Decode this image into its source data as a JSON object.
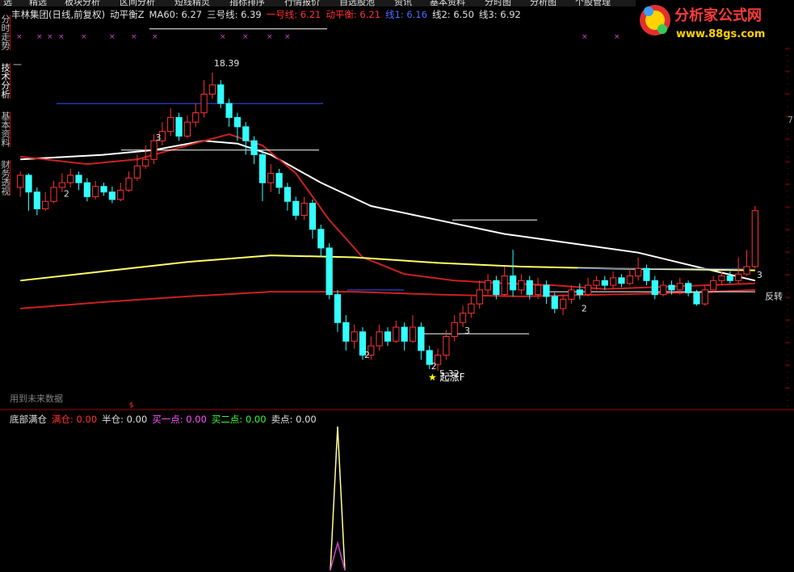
{
  "menu": [
    "选",
    "精选",
    "板块分析",
    "区间分析",
    "短线精灵",
    "指标排序",
    "行情报价",
    "自选股池",
    "资讯",
    "基本资料",
    "分时图",
    "分析图",
    "个股管理"
  ],
  "sidebar_tabs": [
    "分时走势",
    "技术分析",
    "基本资料",
    "财务透视"
  ],
  "legend_main": [
    {
      "text": "丰林集团(日线,前复权)",
      "color": "#e0e0e0"
    },
    {
      "text": "动平衡Z",
      "color": "#e0e0e0"
    },
    {
      "text": "MA60: 6.27",
      "color": "#e0e0e0"
    },
    {
      "text": "三号线: 6.39",
      "color": "#e0e0e0"
    },
    {
      "text": "一号线: 6.21",
      "color": "#ff3333"
    },
    {
      "text": "动平衡: 6.21",
      "color": "#ff3333"
    },
    {
      "text": "线1: 6.16",
      "color": "#4f6bff"
    },
    {
      "text": "线2: 6.50",
      "color": "#e0e0e0"
    },
    {
      "text": "线3: 6.92",
      "color": "#e0e0e0"
    }
  ],
  "legend_sub": [
    {
      "text": "底部满仓",
      "color": "#e0e0e0"
    },
    {
      "text": "满仓: 0.00",
      "color": "#ff3333"
    },
    {
      "text": "半仓: 0.00",
      "color": "#e0e0e0"
    },
    {
      "text": "买一点: 0.00",
      "color": "#ff55ff"
    },
    {
      "text": "买二点: 0.00",
      "color": "#33ff33"
    },
    {
      "text": "卖点: 0.00",
      "color": "#e0e0e0"
    }
  ],
  "logo": {
    "title": "分析家公式网",
    "url": "www.88gs.com"
  },
  "future_note": "用到未来数据",
  "signal_label": "起涨F",
  "side_labels": {
    "left_mark": "一",
    "right_mark": "7"
  },
  "chart_data": {
    "type": "candlestick",
    "series_note": "daily candles, front-adjusted",
    "candles": [
      [
        0,
        6.05,
        6.18,
        6.22,
        5.95
      ],
      [
        1,
        6.18,
        6.0,
        6.2,
        5.8
      ],
      [
        2,
        6.0,
        5.82,
        6.05,
        5.75
      ],
      [
        3,
        5.82,
        5.9,
        6.0,
        5.8
      ],
      [
        4,
        5.9,
        6.05,
        6.12,
        5.88
      ],
      [
        5,
        6.05,
        6.1,
        6.2,
        6.0
      ],
      [
        6,
        6.1,
        6.18,
        6.25,
        6.05
      ],
      [
        7,
        6.18,
        6.1,
        6.22,
        6.02
      ],
      [
        8,
        6.1,
        5.95,
        6.15,
        5.9
      ],
      [
        9,
        5.95,
        6.06,
        6.12,
        5.92
      ],
      [
        10,
        6.06,
        6.0,
        6.1,
        5.96
      ],
      [
        11,
        6.0,
        5.92,
        6.06,
        5.88
      ],
      [
        12,
        5.92,
        6.02,
        6.1,
        5.9
      ],
      [
        13,
        6.02,
        6.15,
        6.22,
        6.0
      ],
      [
        14,
        6.15,
        6.28,
        6.4,
        6.12
      ],
      [
        15,
        6.28,
        6.35,
        6.5,
        6.25
      ],
      [
        16,
        6.35,
        6.55,
        6.62,
        6.3
      ],
      [
        17,
        6.55,
        6.65,
        6.75,
        6.5
      ],
      [
        18,
        6.65,
        6.8,
        6.9,
        6.6
      ],
      [
        19,
        6.8,
        6.6,
        6.85,
        6.55
      ],
      [
        20,
        6.6,
        6.75,
        6.82,
        6.58
      ],
      [
        21,
        6.75,
        6.85,
        6.95,
        6.7
      ],
      [
        22,
        6.85,
        7.05,
        7.2,
        6.8
      ],
      [
        23,
        7.05,
        7.15,
        7.28,
        7.0
      ],
      [
        24,
        7.15,
        6.95,
        7.2,
        6.9
      ],
      [
        25,
        6.95,
        6.8,
        7.0,
        6.7
      ],
      [
        26,
        6.8,
        6.7,
        6.85,
        6.55
      ],
      [
        27,
        6.7,
        6.55,
        6.75,
        6.4
      ],
      [
        28,
        6.55,
        6.4,
        6.6,
        6.3
      ],
      [
        29,
        6.4,
        6.1,
        6.45,
        5.9
      ],
      [
        30,
        6.1,
        6.2,
        6.3,
        6.0
      ],
      [
        31,
        6.2,
        6.05,
        6.25,
        5.98
      ],
      [
        32,
        6.05,
        5.9,
        6.1,
        5.8
      ],
      [
        33,
        5.9,
        5.75,
        5.95,
        5.7
      ],
      [
        34,
        5.75,
        5.88,
        5.95,
        5.7
      ],
      [
        35,
        5.88,
        5.6,
        5.92,
        5.5
      ],
      [
        36,
        5.6,
        5.4,
        5.65,
        5.3
      ],
      [
        37,
        5.4,
        4.9,
        5.45,
        4.85
      ],
      [
        38,
        4.9,
        4.6,
        4.95,
        4.5
      ],
      [
        39,
        4.6,
        4.4,
        4.68,
        4.3
      ],
      [
        40,
        4.4,
        4.5,
        4.58,
        4.32
      ],
      [
        41,
        4.5,
        4.25,
        4.55,
        4.2
      ],
      [
        42,
        4.25,
        4.35,
        4.45,
        4.2
      ],
      [
        43,
        4.35,
        4.5,
        4.58,
        4.3
      ],
      [
        44,
        4.5,
        4.4,
        4.55,
        4.35
      ],
      [
        45,
        4.4,
        4.55,
        4.62,
        4.38
      ],
      [
        46,
        4.55,
        4.4,
        4.6,
        4.3
      ],
      [
        47,
        4.4,
        4.55,
        4.68,
        4.38
      ],
      [
        48,
        4.55,
        4.3,
        4.6,
        4.2
      ],
      [
        49,
        4.3,
        4.15,
        4.35,
        4.1
      ],
      [
        50,
        4.15,
        4.25,
        4.32,
        4.08
      ],
      [
        51,
        4.25,
        4.45,
        4.52,
        4.2
      ],
      [
        52,
        4.45,
        4.6,
        4.68,
        4.4
      ],
      [
        53,
        4.6,
        4.7,
        4.78,
        4.55
      ],
      [
        54,
        4.7,
        4.8,
        4.88,
        4.65
      ],
      [
        55,
        4.8,
        4.95,
        5.05,
        4.75
      ],
      [
        56,
        4.95,
        5.05,
        5.12,
        4.9
      ],
      [
        57,
        5.05,
        4.9,
        5.1,
        4.85
      ],
      [
        58,
        4.9,
        5.1,
        5.2,
        4.88
      ],
      [
        59,
        5.1,
        4.95,
        5.38,
        4.88
      ],
      [
        60,
        4.95,
        5.05,
        5.12,
        4.9
      ],
      [
        61,
        5.05,
        4.9,
        5.1,
        4.85
      ],
      [
        62,
        4.9,
        5.0,
        5.08,
        4.85
      ],
      [
        63,
        5.0,
        4.88,
        5.05,
        4.8
      ],
      [
        64,
        4.88,
        4.75,
        4.92,
        4.7
      ],
      [
        65,
        4.75,
        4.85,
        4.9,
        4.68
      ],
      [
        66,
        4.85,
        4.95,
        5.0,
        4.8
      ],
      [
        67,
        4.95,
        4.9,
        5.02,
        4.85
      ],
      [
        68,
        4.9,
        5.0,
        5.08,
        4.88
      ],
      [
        69,
        5.0,
        5.05,
        5.1,
        4.95
      ],
      [
        70,
        5.05,
        5.0,
        5.1,
        4.95
      ],
      [
        71,
        5.0,
        5.08,
        5.15,
        4.96
      ],
      [
        72,
        5.08,
        5.02,
        5.12,
        4.98
      ],
      [
        73,
        5.02,
        5.1,
        5.18,
        5.0
      ],
      [
        74,
        5.1,
        5.18,
        5.3,
        5.05
      ],
      [
        75,
        5.18,
        5.05,
        5.22,
        5.0
      ],
      [
        76,
        5.05,
        4.9,
        5.1,
        4.85
      ],
      [
        77,
        4.9,
        5.0,
        5.05,
        4.88
      ],
      [
        78,
        5.0,
        4.95,
        5.05,
        4.9
      ],
      [
        79,
        4.95,
        5.02,
        5.08,
        4.9
      ],
      [
        80,
        5.02,
        4.92,
        5.05,
        4.88
      ],
      [
        81,
        4.92,
        4.8,
        4.95,
        4.78
      ],
      [
        82,
        4.8,
        4.95,
        5.0,
        4.78
      ],
      [
        83,
        4.95,
        5.05,
        5.1,
        4.92
      ],
      [
        84,
        5.05,
        5.1,
        5.15,
        5.0
      ],
      [
        85,
        5.1,
        5.05,
        5.15,
        5.02
      ],
      [
        86,
        5.05,
        5.12,
        5.3,
        5.02
      ],
      [
        87,
        5.12,
        5.2,
        5.38,
        5.1
      ],
      [
        88,
        5.2,
        5.8,
        5.85,
        5.18
      ]
    ],
    "lines": [
      {
        "name": "线3",
        "color": "#ffffff",
        "values": [
          [
            0,
            6.35
          ],
          [
            10,
            6.4
          ],
          [
            16,
            6.45
          ],
          [
            22,
            6.55
          ],
          [
            26,
            6.52
          ],
          [
            30,
            6.4
          ],
          [
            36,
            6.1
          ],
          [
            42,
            5.85
          ],
          [
            50,
            5.7
          ],
          [
            58,
            5.55
          ],
          [
            66,
            5.45
          ],
          [
            74,
            5.35
          ],
          [
            80,
            5.22
          ],
          [
            88,
            5.05
          ]
        ]
      },
      {
        "name": "三号线",
        "color": "#cc2020",
        "values": [
          [
            0,
            6.38
          ],
          [
            8,
            6.3
          ],
          [
            14,
            6.35
          ],
          [
            20,
            6.5
          ],
          [
            25,
            6.62
          ],
          [
            29,
            6.5
          ],
          [
            33,
            6.2
          ],
          [
            37,
            5.7
          ],
          [
            41,
            5.3
          ],
          [
            46,
            5.12
          ],
          [
            52,
            5.05
          ],
          [
            58,
            5.02
          ],
          [
            64,
            5.0
          ],
          [
            70,
            4.96
          ],
          [
            76,
            4.98
          ],
          [
            82,
            5.0
          ],
          [
            88,
            5.02
          ]
        ]
      },
      {
        "name": "MA60",
        "color": "#ffff66",
        "values": [
          [
            0,
            5.05
          ],
          [
            10,
            5.15
          ],
          [
            20,
            5.25
          ],
          [
            30,
            5.32
          ],
          [
            40,
            5.3
          ],
          [
            50,
            5.24
          ],
          [
            60,
            5.2
          ],
          [
            70,
            5.18
          ],
          [
            80,
            5.17
          ],
          [
            88,
            5.16
          ]
        ]
      },
      {
        "name": "动平衡",
        "color": "#cc2020",
        "values": [
          [
            0,
            4.75
          ],
          [
            10,
            4.82
          ],
          [
            20,
            4.88
          ],
          [
            30,
            4.93
          ],
          [
            40,
            4.93
          ],
          [
            50,
            4.9
          ],
          [
            60,
            4.88
          ],
          [
            70,
            4.9
          ],
          [
            80,
            4.92
          ],
          [
            88,
            4.95
          ]
        ]
      }
    ],
    "annotations": [
      {
        "index": 23,
        "price": 7.35,
        "text": "18.39"
      },
      {
        "index": 50,
        "price": 4.02,
        "text": "5.32"
      },
      {
        "index": 16,
        "price": 6.55,
        "text": "3"
      },
      {
        "index": 5,
        "price": 5.95,
        "text": "2"
      },
      {
        "index": 41,
        "price": 4.22,
        "text": "2"
      },
      {
        "index": 49,
        "price": 4.1,
        "text": "2"
      },
      {
        "index": 53,
        "price": 4.48,
        "text": "3"
      },
      {
        "index": 67,
        "price": 4.72,
        "text": "2"
      },
      {
        "index": 88,
        "price": 5.08,
        "text": "3"
      },
      {
        "index": 89,
        "price": 4.85,
        "text": "反转"
      }
    ],
    "ylim": [
      3.9,
      7.8
    ],
    "sub_chart": {
      "spike_index": 38,
      "spike_value": 1.0,
      "ylim": [
        0,
        1.0
      ]
    }
  }
}
